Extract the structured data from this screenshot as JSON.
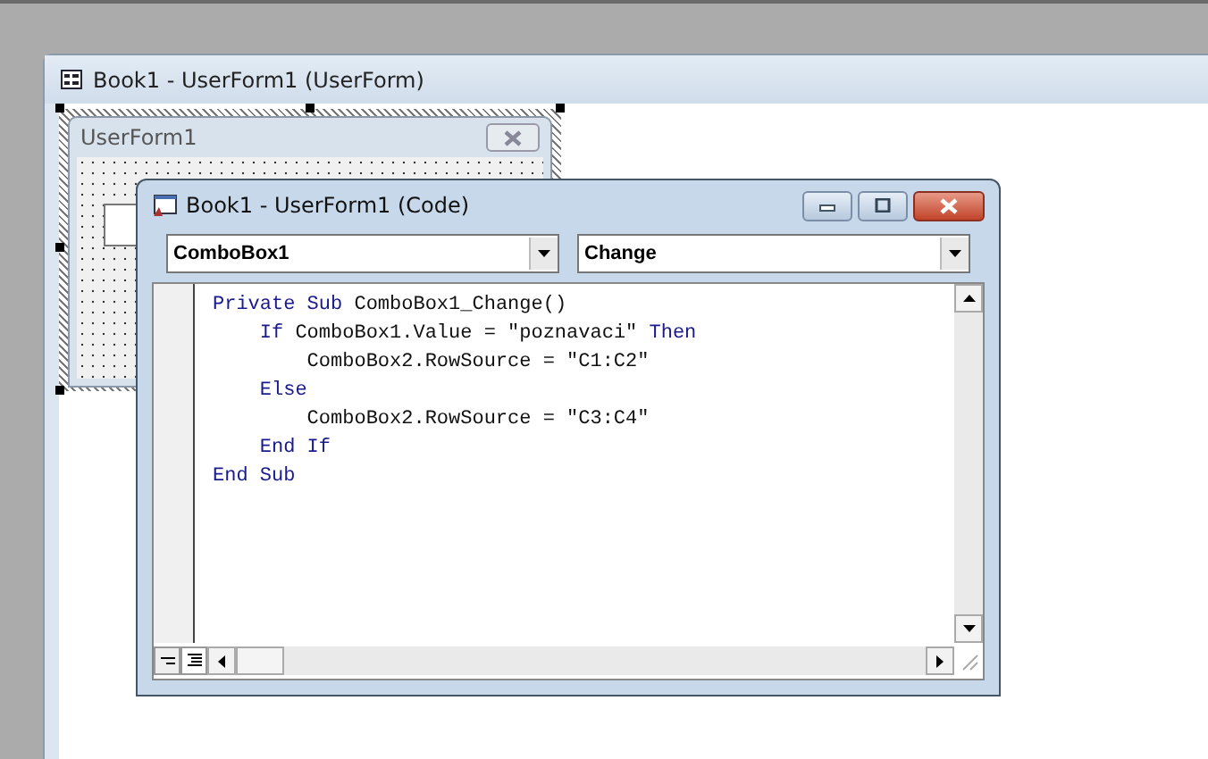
{
  "designer_window": {
    "title": "Book1 - UserForm1 (UserForm)"
  },
  "userform": {
    "title": "UserForm1"
  },
  "code_window": {
    "title": "Book1 - UserForm1 (Code)",
    "object_dropdown": {
      "value": "ComboBox1"
    },
    "procedure_dropdown": {
      "value": "Change"
    },
    "lines": [
      [
        {
          "kind": "keyword",
          "text": "Private Sub"
        },
        {
          "kind": "plain",
          "text": " ComboBox1_Change()"
        }
      ],
      [
        {
          "kind": "keyword",
          "text": "    If"
        },
        {
          "kind": "plain",
          "text": " ComboBox1.Value = \"poznavaci\" "
        },
        {
          "kind": "keyword",
          "text": "Then"
        }
      ],
      [
        {
          "kind": "plain",
          "text": "        ComboBox2.RowSource = \"C1:C2\""
        }
      ],
      [
        {
          "kind": "keyword",
          "text": "    Else"
        }
      ],
      [
        {
          "kind": "plain",
          "text": "        ComboBox2.RowSource = \"C3:C4\""
        }
      ],
      [
        {
          "kind": "keyword",
          "text": "    End If"
        }
      ],
      [
        {
          "kind": "keyword",
          "text": "End Sub"
        }
      ]
    ]
  }
}
